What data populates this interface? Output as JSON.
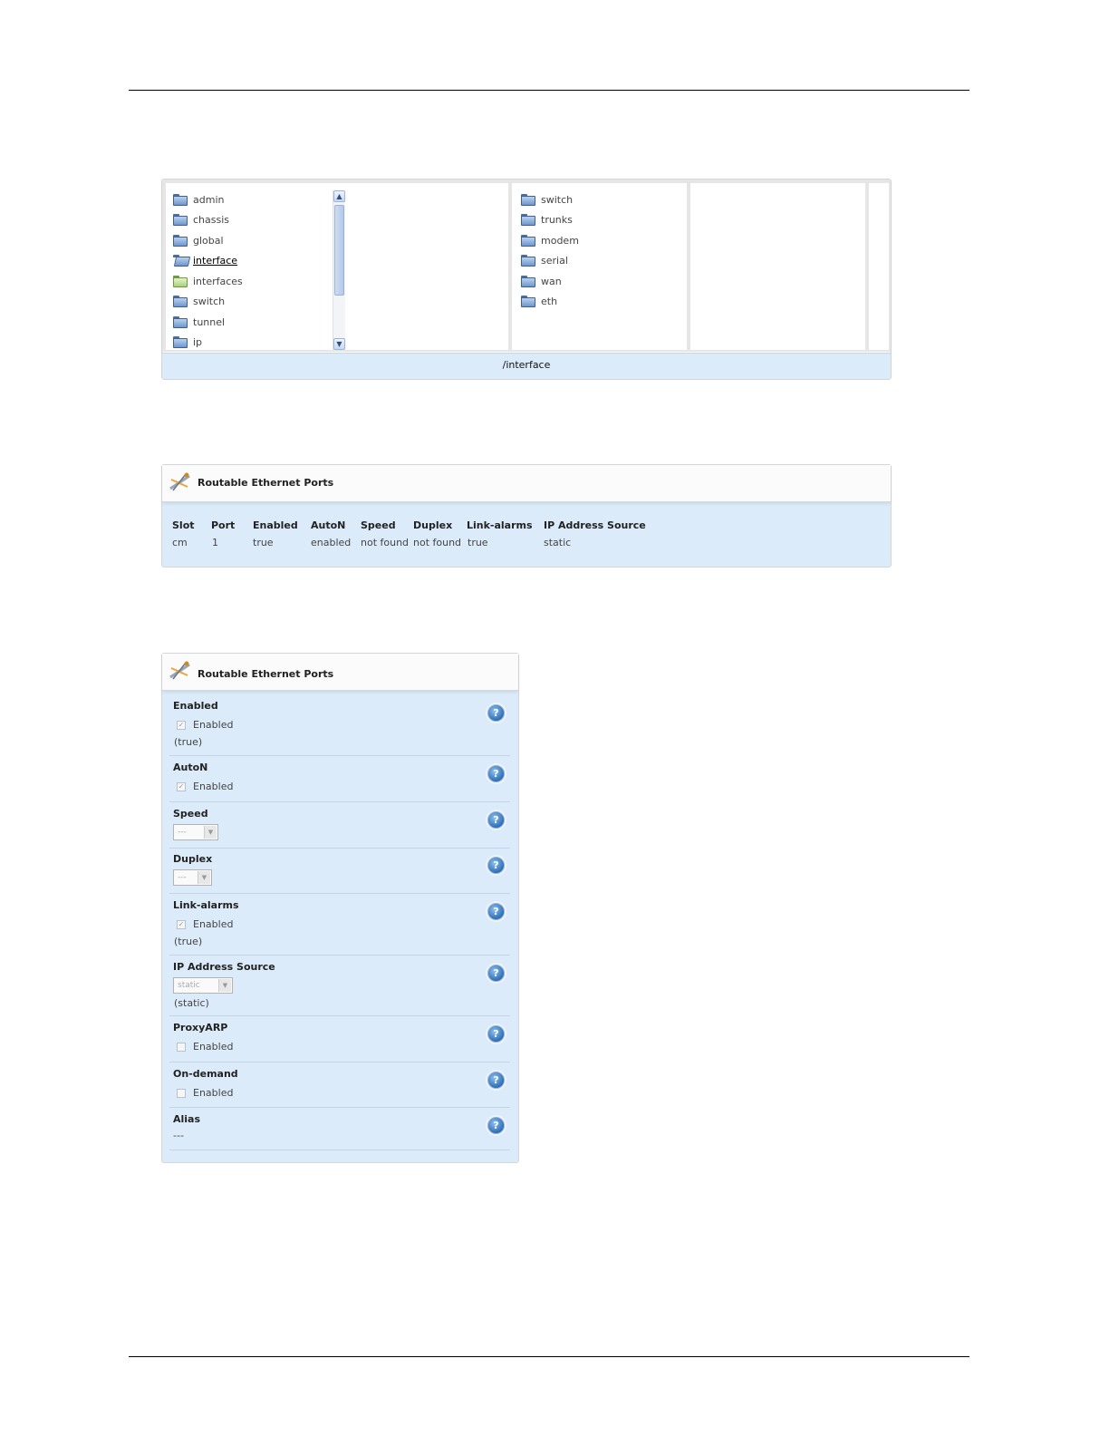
{
  "browser": {
    "col1": [
      "admin",
      "chassis",
      "global",
      "interface",
      "interfaces",
      "switch",
      "tunnel",
      "ip"
    ],
    "col2": [
      "switch",
      "trunks",
      "modem",
      "serial",
      "wan",
      "eth"
    ],
    "path": "/interface"
  },
  "ports_table": {
    "title": "Routable Ethernet Ports",
    "headers": [
      "Slot",
      "Port",
      "Enabled",
      "AutoN",
      "Speed",
      "Duplex",
      "Link-alarms",
      "IP Address Source"
    ],
    "row": [
      "cm",
      "1",
      "true",
      "enabled",
      "not found",
      "not found",
      "true",
      "static"
    ]
  },
  "ports_form": {
    "title": "Routable Ethernet Ports",
    "enabled_label": "Enabled",
    "enabled_check": "Enabled",
    "enabled_note": "(true)",
    "auton_label": "AutoN",
    "auton_check": "Enabled",
    "speed_label": "Speed",
    "speed_value": "---",
    "duplex_label": "Duplex",
    "duplex_value": "---",
    "linkalarms_label": "Link-alarms",
    "linkalarms_check": "Enabled",
    "linkalarms_note": "(true)",
    "ipsource_label": "IP Address Source",
    "ipsource_value": "static",
    "ipsource_note": "(static)",
    "proxyarp_label": "ProxyARP",
    "proxyarp_check": "Enabled",
    "ondemand_label": "On-demand",
    "ondemand_check": "Enabled",
    "alias_label": "Alias",
    "alias_value": "---",
    "help_glyph": "?"
  }
}
